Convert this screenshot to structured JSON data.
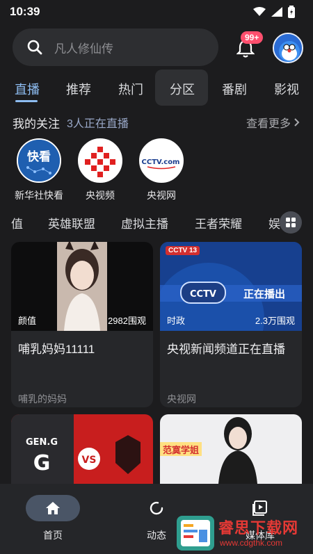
{
  "status": {
    "time": "10:39"
  },
  "search": {
    "placeholder": "凡人修仙传"
  },
  "notifications": {
    "badge": "99+"
  },
  "tabs": [
    {
      "label": "直播",
      "active": true
    },
    {
      "label": "推荐"
    },
    {
      "label": "热门"
    },
    {
      "label": "分区",
      "selected": true
    },
    {
      "label": "番剧"
    },
    {
      "label": "影视"
    }
  ],
  "following": {
    "title": "我的关注",
    "live_count": "3人正在直播",
    "more": "查看更多"
  },
  "channels": [
    {
      "name": "新华社快看",
      "logo_text": "快看"
    },
    {
      "name": "央视频"
    },
    {
      "name": "央视网",
      "logo_text": "CCTV.com"
    }
  ],
  "categories": [
    "值",
    "英雄联盟",
    "虚拟主播",
    "王者荣耀",
    "娱"
  ],
  "cards": [
    {
      "tag": "颜值",
      "views": "2982围观",
      "title": "哺乳妈妈11111",
      "anchor": "哺乳的妈妈"
    },
    {
      "tag": "时政",
      "views": "2.3万围观",
      "title": "央视新闻频道正在直播",
      "anchor": "央视网",
      "thumb_text": "正在播出",
      "thumb_logo": "CCTV 13"
    },
    {
      "thumb_text": "GEN.G"
    },
    {
      "thumb_text": "范寞学姐"
    }
  ],
  "nav": [
    {
      "label": "首页",
      "icon": "home-icon",
      "active": true
    },
    {
      "label": "动态",
      "icon": "dynamic-icon"
    },
    {
      "label": "媒体库",
      "icon": "library-icon"
    }
  ],
  "watermark": {
    "text": "睿思下载网",
    "url": "www.cdgthk.com"
  },
  "colors": {
    "accent": "#8ebdf2",
    "background": "#1c1c1e",
    "badge": "#ff4f6e"
  }
}
